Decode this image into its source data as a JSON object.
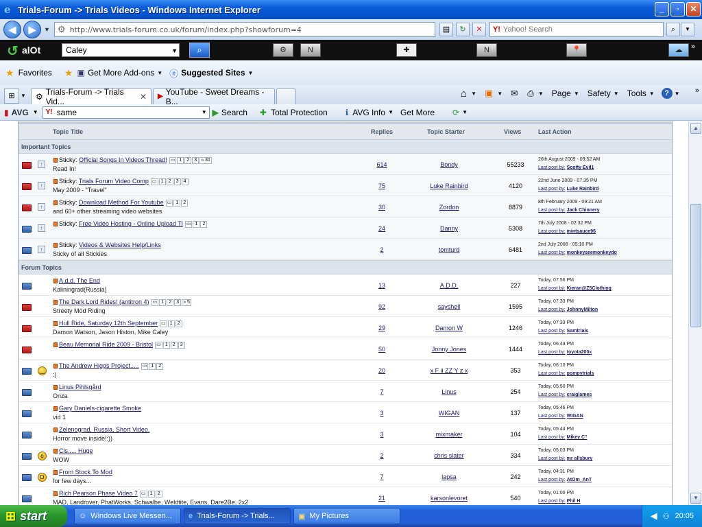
{
  "window": {
    "title": "Trials-Forum -> Trials Videos - Windows Internet Explorer"
  },
  "address": {
    "url": "http://www.trials-forum.co.uk/forum/index.php?showforum=4",
    "search_placeholder": "Yahoo! Search"
  },
  "alot": {
    "logo": "alOt",
    "field_value": "Caley"
  },
  "favorites": {
    "label": "Favorites",
    "addons": "Get More Add-ons",
    "suggested": "Suggested Sites"
  },
  "tabs": [
    {
      "label": "Trials-Forum -> Trials Vid..."
    },
    {
      "label": "YouTube - Sweet Dreams - B..."
    }
  ],
  "command": {
    "page": "Page",
    "safety": "Safety",
    "tools": "Tools"
  },
  "avg": {
    "logo": "AVG",
    "query": "same",
    "search": "Search",
    "protection": "Total Protection",
    "info": "AVG Info",
    "more": "Get More"
  },
  "table": {
    "headers": {
      "title": "Topic Title",
      "replies": "Replies",
      "starter": "Topic Starter",
      "views": "Views",
      "last": "Last Action"
    },
    "important_label": "Important Topics",
    "forum_label": "Forum Topics",
    "last_prefix": "Last post by:",
    "important": [
      {
        "prefix": "Sticky:",
        "title": "Official Songs In Videos Thread!",
        "pages": [
          "1",
          "2",
          "3",
          "» 31"
        ],
        "desc": "Read In!",
        "replies": "614",
        "starter": "Bondy",
        "views": "55233",
        "date": "26th August 2009 - 09:52 AM",
        "last": "Scotty Evil1",
        "folder": "red"
      },
      {
        "prefix": "Sticky:",
        "title": "Trials Forum Video Comp",
        "pages": [
          "1",
          "2",
          "3",
          "4"
        ],
        "desc": "May 2009 - \"Travel\"",
        "replies": "75",
        "starter": "Luke Rainbird",
        "views": "4120",
        "date": "22nd June 2009 - 07:35 PM",
        "last": "Luke Rainbird",
        "folder": "red"
      },
      {
        "prefix": "Sticky:",
        "title": "Download Method For Youtube",
        "pages": [
          "1",
          "2"
        ],
        "desc": "and 60+ other streaming video websites",
        "replies": "30",
        "starter": "Zordon",
        "views": "8879",
        "date": "8th February 2009 - 09:21 AM",
        "last": "Jack Chinnery",
        "folder": "red"
      },
      {
        "prefix": "Sticky:",
        "title": "Free Video Hosting - Online Upload Tl",
        "pages": [
          "1",
          "2"
        ],
        "desc": "",
        "replies": "24",
        "starter": "Danny",
        "views": "5308",
        "date": "7th July 2008 - 02:32 PM",
        "last": "mintsauce96",
        "folder": "blue"
      },
      {
        "prefix": "Sticky:",
        "title": "Videos & Websites Help/Links",
        "pages": [],
        "desc": "Sticky of all Stickies",
        "replies": "2",
        "starter": "tomturd",
        "views": "6481",
        "date": "2nd July 2008 - 05:10 PM",
        "last": "monkeyseemonkeydo",
        "folder": "blue"
      }
    ],
    "forum": [
      {
        "title": "A.d.d. The End",
        "pages": [],
        "desc": "Kaliningrad(Russia)",
        "replies": "13",
        "starter": "A.D.D.",
        "views": "227",
        "date": "Today, 07:56 PM",
        "last": "Kieran@Z5Clothing",
        "folder": "blue",
        "emoji": ""
      },
      {
        "title": "The Dark Lord Rides! (antitron 4)",
        "pages": [
          "1",
          "2",
          "3",
          "» 5"
        ],
        "desc": "Streety Mod Riding",
        "replies": "92",
        "starter": "sayshell",
        "views": "1595",
        "date": "Today, 07:33 PM",
        "last": "JohnnyMilton",
        "folder": "red",
        "emoji": ""
      },
      {
        "title": "Hull Ride, Saturday 12th September",
        "pages": [
          "1",
          "2"
        ],
        "desc": "Damon Watson, Jason Histon, Mike Caley",
        "replies": "29",
        "starter": "Damon W",
        "views": "1246",
        "date": "Today, 07:33 PM",
        "last": "Samtrials",
        "folder": "red",
        "emoji": ""
      },
      {
        "title": "Beau Memorial Ride 2009 - Bristol",
        "pages": [
          "1",
          "2",
          "3"
        ],
        "desc": "",
        "replies": "50",
        "starter": "Jonny Jones",
        "views": "1444",
        "date": "Today, 06:43 PM",
        "last": "toyota200x",
        "folder": "red",
        "emoji": ""
      },
      {
        "title": "The Andrew Higgs Project.....",
        "pages": [
          "1",
          "2"
        ],
        "desc": ":)",
        "replies": "20",
        "starter": "x F ii ZZ Y z x",
        "views": "353",
        "date": "Today, 06:10 PM",
        "last": "pompytrials",
        "folder": "blue",
        "emoji": "smile"
      },
      {
        "title": "Linus Pihlsgård",
        "pages": [],
        "desc": "Onza",
        "replies": "7",
        "starter": "Linus",
        "views": "254",
        "date": "Today, 05:50 PM",
        "last": "craiglames",
        "folder": "blue",
        "emoji": ""
      },
      {
        "title": "Gary Daniels-cigarette Smoke",
        "pages": [],
        "desc": "vid 1",
        "replies": "3",
        "starter": "WIGAN",
        "views": "137",
        "date": "Today, 05:46 PM",
        "last": "WIGAN",
        "folder": "blue",
        "emoji": ""
      },
      {
        "title": "Zelenograd, Russia. Short Video.",
        "pages": [],
        "desc": "Horror move inside!:))",
        "replies": "3",
        "starter": "mixmaker",
        "views": "104",
        "date": "Today, 05:44 PM",
        "last": "Mikey C\"",
        "folder": "blue",
        "emoji": ""
      },
      {
        "title": "Cls..... Huge",
        "pages": [],
        "desc": "WOW",
        "replies": "2",
        "starter": "chris slater",
        "views": "334",
        "date": "Today, 05:03 PM",
        "last": "mr allsbury",
        "folder": "blue",
        "emoji": "wow"
      },
      {
        "title": "From Stock To Mod",
        "pages": [],
        "desc": "for few days...",
        "replies": "7",
        "starter": "lapsa",
        "views": "242",
        "date": "Today, 04:31 PM",
        "last": "AtOm_AnT",
        "folder": "blue",
        "emoji": "grin"
      },
      {
        "title": "Rich Pearson Phase Video 7",
        "pages": [
          "1",
          "2"
        ],
        "desc": "MAD, Landrover, PhatWorks, Schwalbe, Weldtite, Evans, Dare2Be, 2x2",
        "replies": "21",
        "starter": "karsonlevoret",
        "views": "540",
        "date": "Today, 01:00 PM",
        "last": "Phil H",
        "folder": "blue",
        "emoji": ""
      }
    ]
  },
  "taskbar": {
    "start": "start",
    "items": [
      "Windows Live Messen...",
      "Trials-Forum -> Trials...",
      "My Pictures"
    ],
    "clock": "20:05"
  }
}
